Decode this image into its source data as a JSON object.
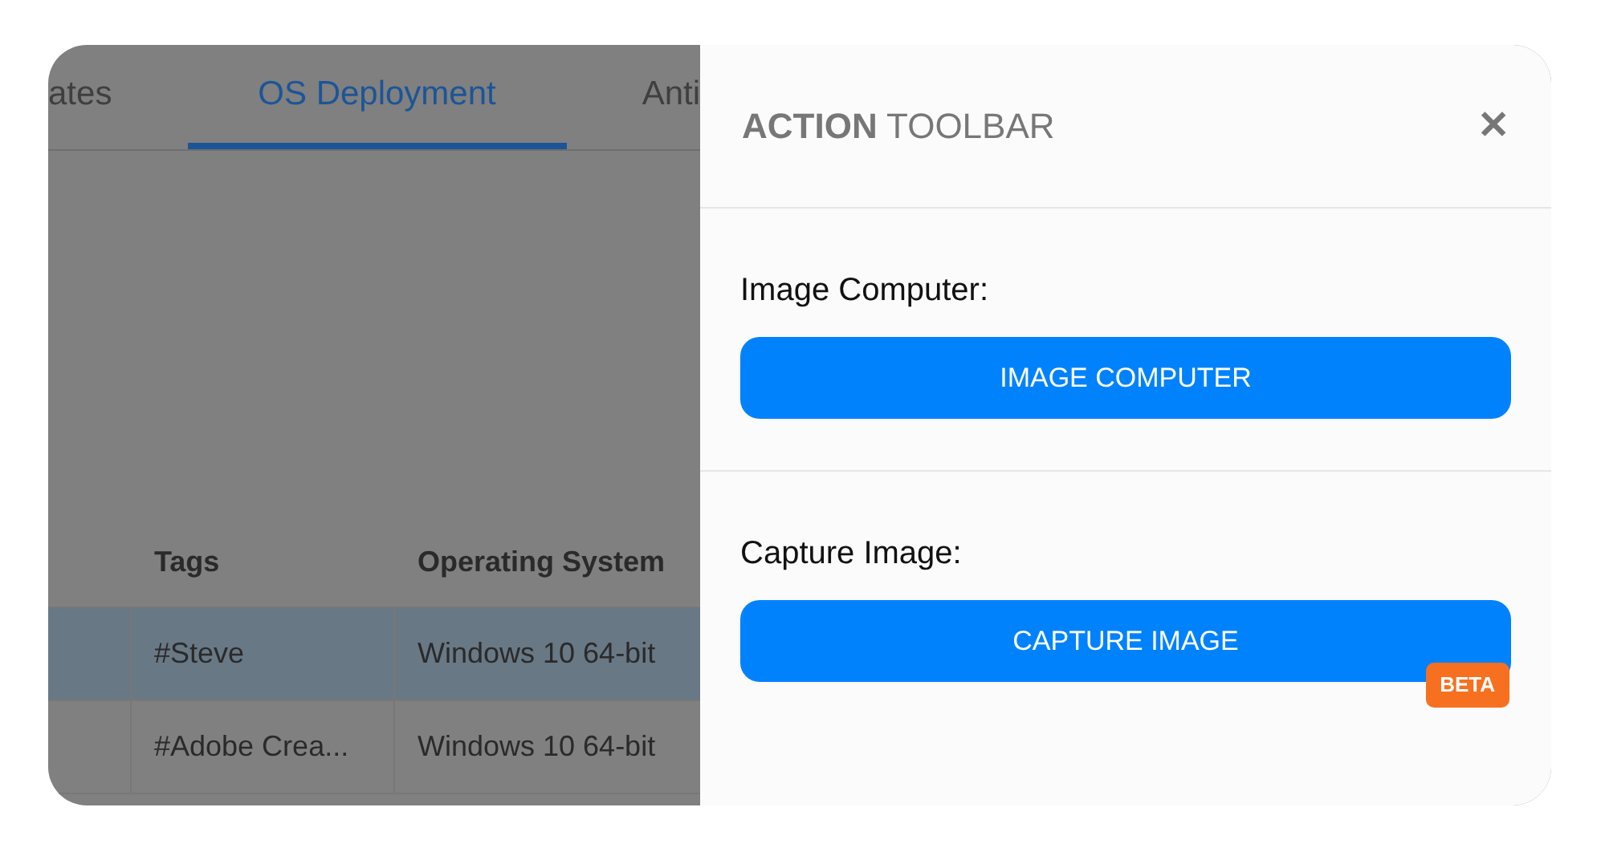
{
  "tabs": [
    {
      "label": "ates",
      "selected": false
    },
    {
      "label": "OS Deployment",
      "selected": true
    },
    {
      "label": "Anti",
      "selected": false
    }
  ],
  "table": {
    "columns": [
      "Tags",
      "Operating System"
    ],
    "rows": [
      {
        "selected": true,
        "cells": [
          "#Steve",
          "Windows 10 64-bit"
        ]
      },
      {
        "selected": false,
        "cells": [
          "#Adobe Crea...",
          "Windows 10 64-bit"
        ]
      }
    ]
  },
  "panel": {
    "title": "**ACTION** TOOLBAR",
    "close": "✕",
    "sections": [
      {
        "label": "Image Computer:",
        "button": "IMAGE COMPUTER"
      },
      {
        "label": "Capture Image:",
        "button": "CAPTURE IMAGE",
        "badge": "BETA"
      }
    ]
  }
}
